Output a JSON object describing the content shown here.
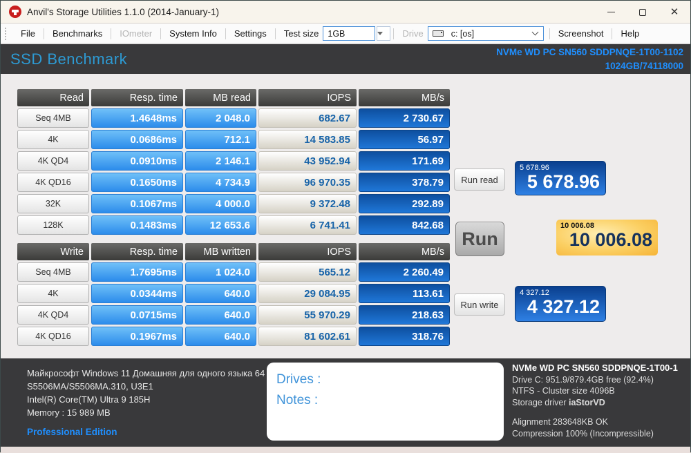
{
  "window": {
    "title": "Anvil's Storage Utilities 1.1.0 (2014-January-1)"
  },
  "menubar": {
    "file": "File",
    "benchmarks": "Benchmarks",
    "iometer": "IOmeter",
    "system_info": "System Info",
    "settings": "Settings",
    "test_size_label": "Test size",
    "test_size_value": "1GB",
    "drive_label": "Drive",
    "drive_value": "c: [os]",
    "screenshot": "Screenshot",
    "help": "Help"
  },
  "header": {
    "title": "SSD Benchmark",
    "device": "NVMe WD PC SN560 SDDPNQE-1T00-1102",
    "capacity": "1024GB/74118000"
  },
  "read_table": {
    "headers": [
      "Read",
      "Resp. time",
      "MB read",
      "IOPS",
      "MB/s"
    ],
    "rows": [
      {
        "label": "Seq 4MB",
        "resp": "1.4648ms",
        "mb": "2 048.0",
        "iops": "682.67",
        "mbs": "2 730.67"
      },
      {
        "label": "4K",
        "resp": "0.0686ms",
        "mb": "712.1",
        "iops": "14 583.85",
        "mbs": "56.97"
      },
      {
        "label": "4K QD4",
        "resp": "0.0910ms",
        "mb": "2 146.1",
        "iops": "43 952.94",
        "mbs": "171.69"
      },
      {
        "label": "4K QD16",
        "resp": "0.1650ms",
        "mb": "4 734.9",
        "iops": "96 970.35",
        "mbs": "378.79"
      },
      {
        "label": "32K",
        "resp": "0.1067ms",
        "mb": "4 000.0",
        "iops": "9 372.48",
        "mbs": "292.89"
      },
      {
        "label": "128K",
        "resp": "0.1483ms",
        "mb": "12 653.6",
        "iops": "6 741.41",
        "mbs": "842.68"
      }
    ]
  },
  "write_table": {
    "headers": [
      "Write",
      "Resp. time",
      "MB written",
      "IOPS",
      "MB/s"
    ],
    "rows": [
      {
        "label": "Seq 4MB",
        "resp": "1.7695ms",
        "mb": "1 024.0",
        "iops": "565.12",
        "mbs": "2 260.49"
      },
      {
        "label": "4K",
        "resp": "0.0344ms",
        "mb": "640.0",
        "iops": "29 084.95",
        "mbs": "113.61"
      },
      {
        "label": "4K QD4",
        "resp": "0.0715ms",
        "mb": "640.0",
        "iops": "55 970.29",
        "mbs": "218.63"
      },
      {
        "label": "4K QD16",
        "resp": "0.1967ms",
        "mb": "640.0",
        "iops": "81 602.61",
        "mbs": "318.76"
      }
    ]
  },
  "buttons": {
    "run_read": "Run read",
    "run": "Run",
    "run_write": "Run write"
  },
  "scores": {
    "read": {
      "small": "5 678.96",
      "big": "5 678.96"
    },
    "total": {
      "small": "10 006.08",
      "big": "10 006.08"
    },
    "write": {
      "small": "4 327.12",
      "big": "4 327.12"
    }
  },
  "footer": {
    "os": "Майкрософт Windows 11 Домашняя для одного языка 64",
    "board": "S5506MA/S5506MA.310, U3E1",
    "cpu": "Intel(R) Core(TM) Ultra 9 185H",
    "memory": "Memory : 15 989 MB",
    "edition": "Professional Edition",
    "drives_label": "Drives :",
    "notes_label": "Notes :",
    "device": "NVMe WD PC SN560 SDDPNQE-1T00-1",
    "drive_line": "Drive C: 951.9/879.4GB free (92.4%)",
    "ntfs": "NTFS - Cluster size 4096B",
    "storage_prefix": "Storage driver ",
    "storage_driver": "iaStorVD",
    "alignment": "Alignment 283648KB OK",
    "compression": "Compression 100% (Incompressible)"
  },
  "colors": {
    "accent_blue": "#1f8fff",
    "cell_blue": "#2c8ceb",
    "cell_navy": "#0e4f9f",
    "score_orange": "#f6b437",
    "panel_dark": "#39393b"
  }
}
